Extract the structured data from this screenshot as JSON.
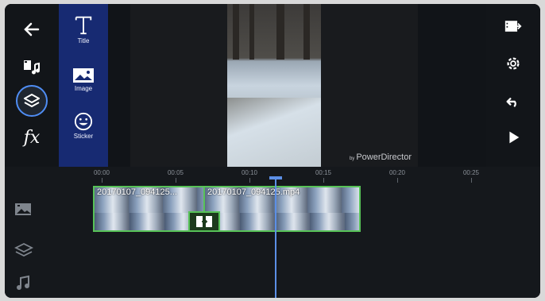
{
  "app": {
    "watermark_prefix": "by",
    "watermark_brand": "PowerDirector"
  },
  "left_rail": [
    {
      "name": "back-icon",
      "icon": "arrow-left"
    },
    {
      "name": "media-music-icon",
      "icon": "film-music"
    },
    {
      "name": "layers-icon",
      "icon": "layers",
      "active": true
    },
    {
      "name": "fx-icon",
      "icon": "fx",
      "text": "fx"
    }
  ],
  "layer_panel": {
    "title": "Title",
    "image": "Image",
    "sticker": "Sticker"
  },
  "right_rail": [
    {
      "name": "export-icon"
    },
    {
      "name": "settings-gear-icon"
    },
    {
      "name": "undo-icon"
    },
    {
      "name": "play-icon"
    }
  ],
  "timeline": {
    "ruler_labels": [
      "00:00",
      "00:05",
      "00:10",
      "00:15",
      "00:20",
      "00:25"
    ],
    "clips": [
      {
        "name": "20170107_094125..."
      },
      {
        "name": "20170107_094125.mp4"
      }
    ]
  },
  "colors": {
    "accent": "#4f8df4",
    "layer_panel": "#172a72",
    "clip_border": "#57c257"
  }
}
